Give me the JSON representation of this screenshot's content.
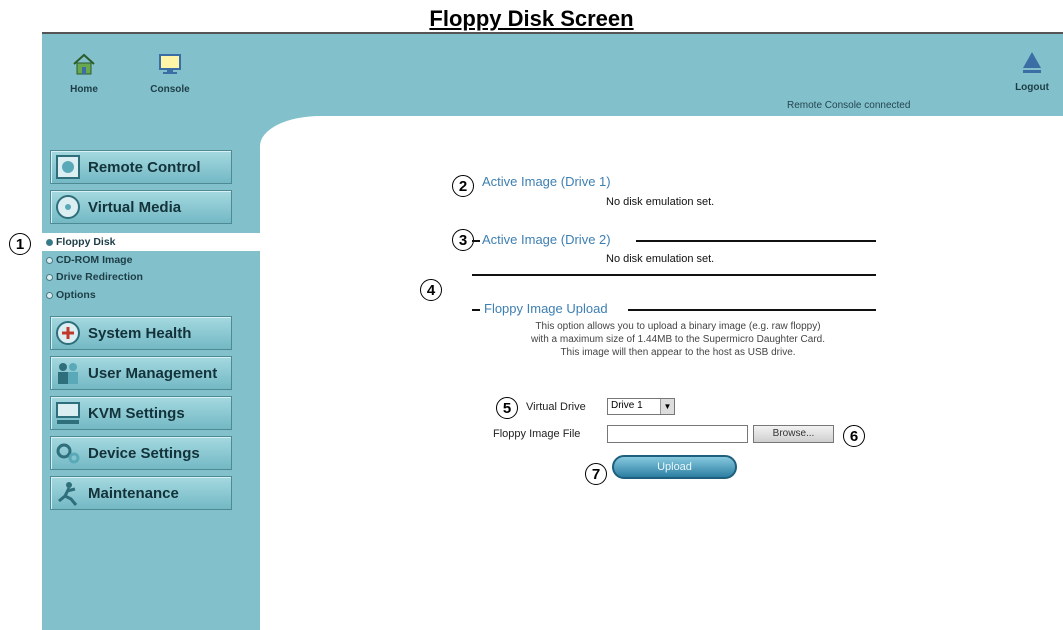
{
  "doc_title": "Floppy Disk Screen",
  "header": {
    "home_label": "Home",
    "console_label": "Console",
    "status": "Remote Console connected",
    "logout_label": "Logout"
  },
  "sidebar": {
    "menus": [
      {
        "label": "Remote Control",
        "icon": "remote-control-icon"
      },
      {
        "label": "Virtual Media",
        "icon": "virtual-media-icon"
      },
      {
        "label": "System Health",
        "icon": "system-health-icon"
      },
      {
        "label": "User Management",
        "icon": "user-management-icon"
      },
      {
        "label": "KVM Settings",
        "icon": "kvm-settings-icon"
      },
      {
        "label": "Device Settings",
        "icon": "device-settings-icon"
      },
      {
        "label": "Maintenance",
        "icon": "maintenance-icon"
      }
    ],
    "submenu": [
      {
        "label": "Floppy Disk",
        "active": true
      },
      {
        "label": "CD-ROM Image",
        "active": false
      },
      {
        "label": "Drive Redirection",
        "active": false
      },
      {
        "label": "Options",
        "active": false
      }
    ]
  },
  "markers": [
    "1",
    "2",
    "3",
    "4",
    "5",
    "6",
    "7"
  ],
  "main": {
    "drive1": {
      "title": "Active Image (Drive 1)",
      "status": "No disk emulation set."
    },
    "drive2": {
      "title": "Active Image (Drive 2)",
      "status": "No disk emulation set."
    },
    "upload_section": {
      "title": "Floppy Image Upload",
      "desc_line1": "This option allows you to upload a binary image (e.g. raw floppy)",
      "desc_line2": "with a maximum size of 1.44MB to the Supermicro Daughter Card.",
      "desc_line3": "This image will then appear to the host as USB drive."
    },
    "form": {
      "virtual_drive_label": "Virtual Drive",
      "virtual_drive_value": "Drive 1",
      "file_label": "Floppy Image File",
      "file_value": "",
      "browse_label": "Browse...",
      "upload_label": "Upload"
    }
  },
  "colors": {
    "panel": "#82c0cb",
    "section_title": "#3e7fb2",
    "upload_button": "#2d7fa2"
  }
}
